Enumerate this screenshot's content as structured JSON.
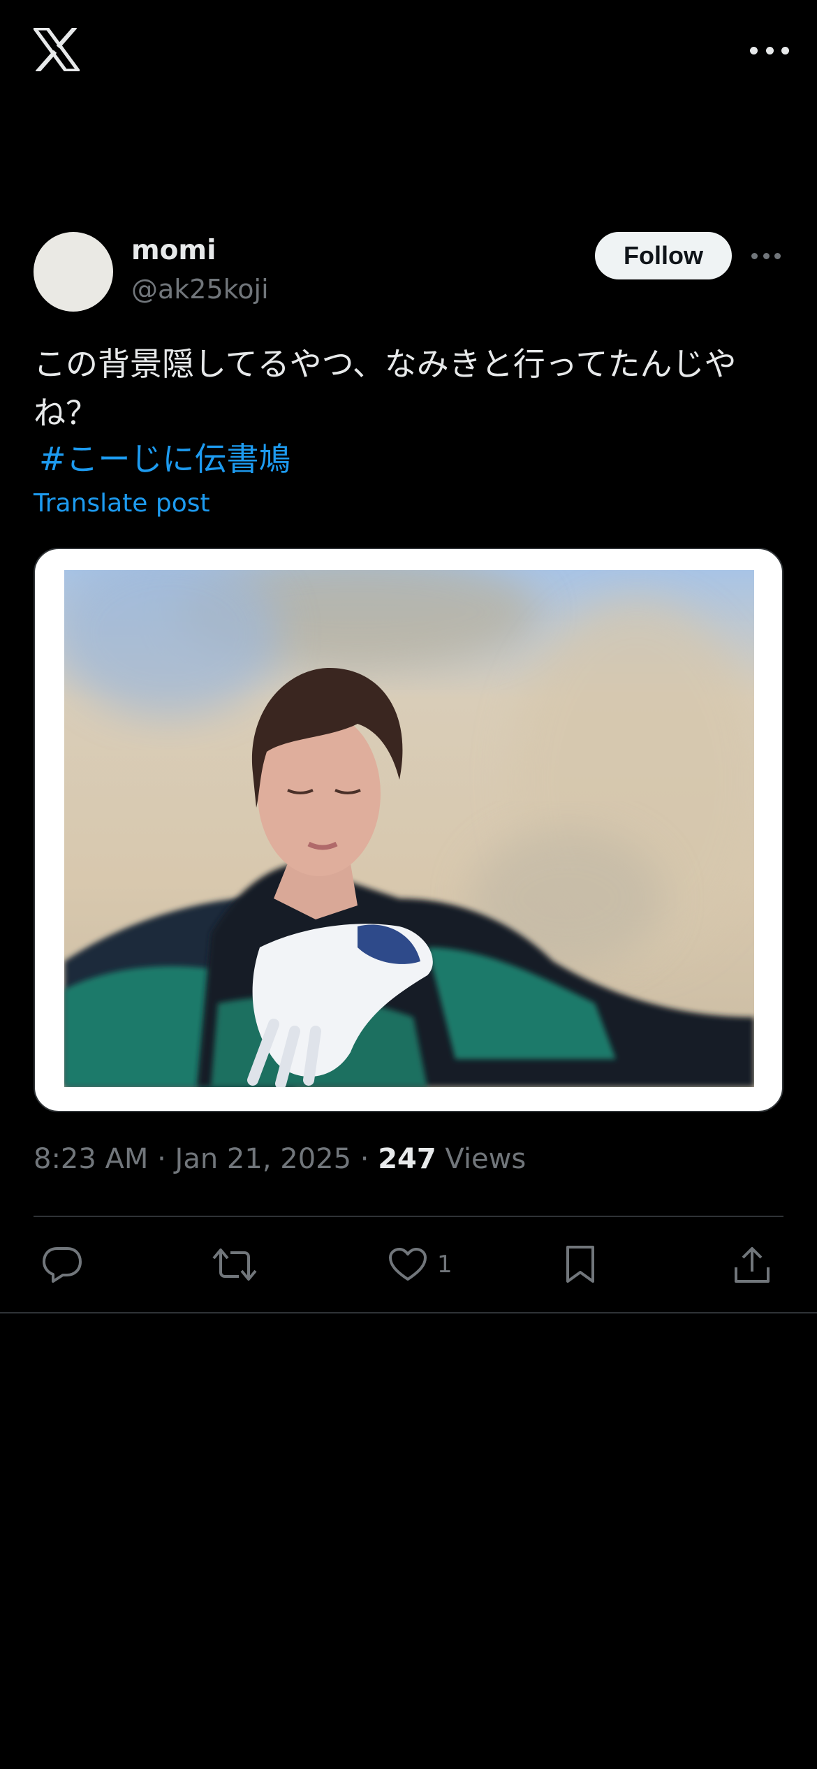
{
  "app": {
    "logo_icon": "x-logo-icon",
    "more_icon": "more-horizontal-icon"
  },
  "post": {
    "author": {
      "display_name": "momi",
      "handle": "@ak25koji"
    },
    "follow_label": "Follow",
    "text": "この背景隠してるやつ、なみきと行ってたんじやね？",
    "hashtag": "#こーじに伝書鳩",
    "translate_label": "Translate post",
    "media": {
      "kind": "photo",
      "frame_color": "#ffffff"
    },
    "timestamp": "8:23 AM · Jan 21, 2025 · ",
    "views_count": "247",
    "views_label": " Views",
    "actions": {
      "reply_icon": "reply-icon",
      "repost_icon": "repost-icon",
      "like_icon": "heart-icon",
      "like_count": "1",
      "bookmark_icon": "bookmark-icon",
      "share_icon": "share-icon"
    }
  },
  "colors": {
    "background": "#000000",
    "text": "#e7e9ea",
    "muted": "#71767b",
    "link": "#1d9bf0",
    "divider": "#2f3336"
  }
}
